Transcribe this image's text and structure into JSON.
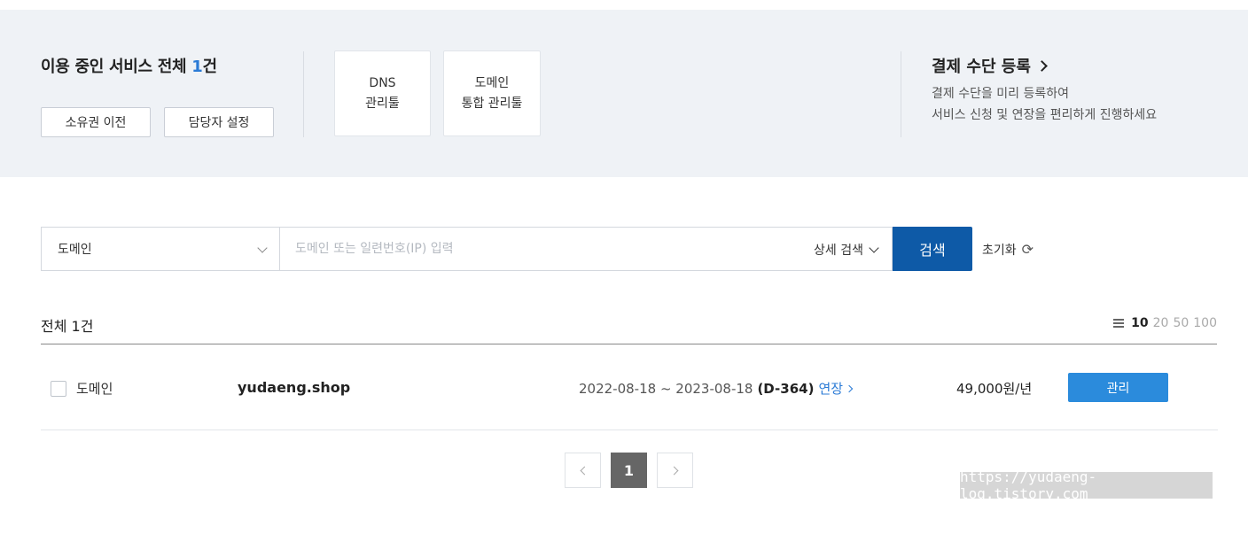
{
  "summary": {
    "title_prefix": "이용 중인 서비스 전체 ",
    "count": "1",
    "title_suffix": "건",
    "transfer_button": "소유권 이전",
    "manager_button": "담당자 설정"
  },
  "tools": [
    {
      "line1": "DNS",
      "line2": "관리툴"
    },
    {
      "line1": "도메인",
      "line2": "통합 관리툴"
    }
  ],
  "payment": {
    "title": "결제 수단 등록",
    "desc1": "결제 수단을 미리 등록하여",
    "desc2": "서비스 신청 및 연장을 편리하게 진행하세요"
  },
  "search": {
    "select_value": "도메인",
    "placeholder": "도메인 또는 일련번호(IP) 입력",
    "value": "",
    "detail_label": "상세 검색",
    "button": "검색",
    "reset": "초기화",
    "reset_icon": "refresh-icon"
  },
  "list": {
    "total": "전체 1건",
    "page_sizes": [
      "10",
      "20",
      "50",
      "100"
    ],
    "selected_page_size": "10"
  },
  "rows": [
    {
      "type": "도메인",
      "domain": "yudaeng.shop",
      "period": "2022-08-18 ~ 2023-08-18",
      "dday": "(D-364)",
      "renew": "연장",
      "price": "49,000원/년",
      "manage": "관리"
    }
  ],
  "pagination": {
    "current": "1"
  },
  "watermark": "https://yudaeng-log.tistory.com",
  "colors": {
    "accent": "#2b7bd6",
    "search_button": "#0e5aa7",
    "manage_button": "#2b8bdc",
    "top_background": "#eff2f6"
  }
}
